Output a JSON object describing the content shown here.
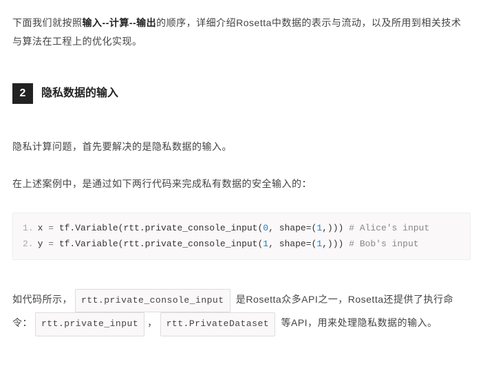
{
  "intro": {
    "pre": "下面我们就按照",
    "bold": "输入--计算--输出",
    "post": "的顺序，详细介绍Rosetta中数据的表示与流动，以及所用到相关技术与算法在工程上的优化实现。"
  },
  "section": {
    "num": "2",
    "title": "隐私数据的输入"
  },
  "p1": "隐私计算问题，首先要解决的是隐私数据的输入。",
  "p2": "在上述案例中，是通过如下两行代码来完成私有数据的安全输入的：",
  "code": {
    "lines": [
      {
        "n": "1.",
        "var": "x",
        "eq": " = ",
        "call_a": "tf.Variable(rtt.private_console_input(",
        "arg0": "0",
        "mid": ", shape=(",
        "arg1": "1",
        "end": ",))) ",
        "cmt": "# Alice's input"
      },
      {
        "n": "2.",
        "var": "y",
        "eq": " = ",
        "call_a": "tf.Variable(rtt.private_console_input(",
        "arg0": "1",
        "mid": ", shape=(",
        "arg1": "1",
        "end": ",))) ",
        "cmt": "# Bob's input"
      }
    ]
  },
  "closing": {
    "t1": "如代码所示，",
    "c1": "rtt.private_console_input",
    "t2": " 是Rosetta众多API之一，Rosetta还提供了执行命令：",
    "c2": "rtt.private_input",
    "t3": "，",
    "c3": "rtt.PrivateDataset",
    "t4": " 等API，用来处理隐私数据的输入。"
  }
}
